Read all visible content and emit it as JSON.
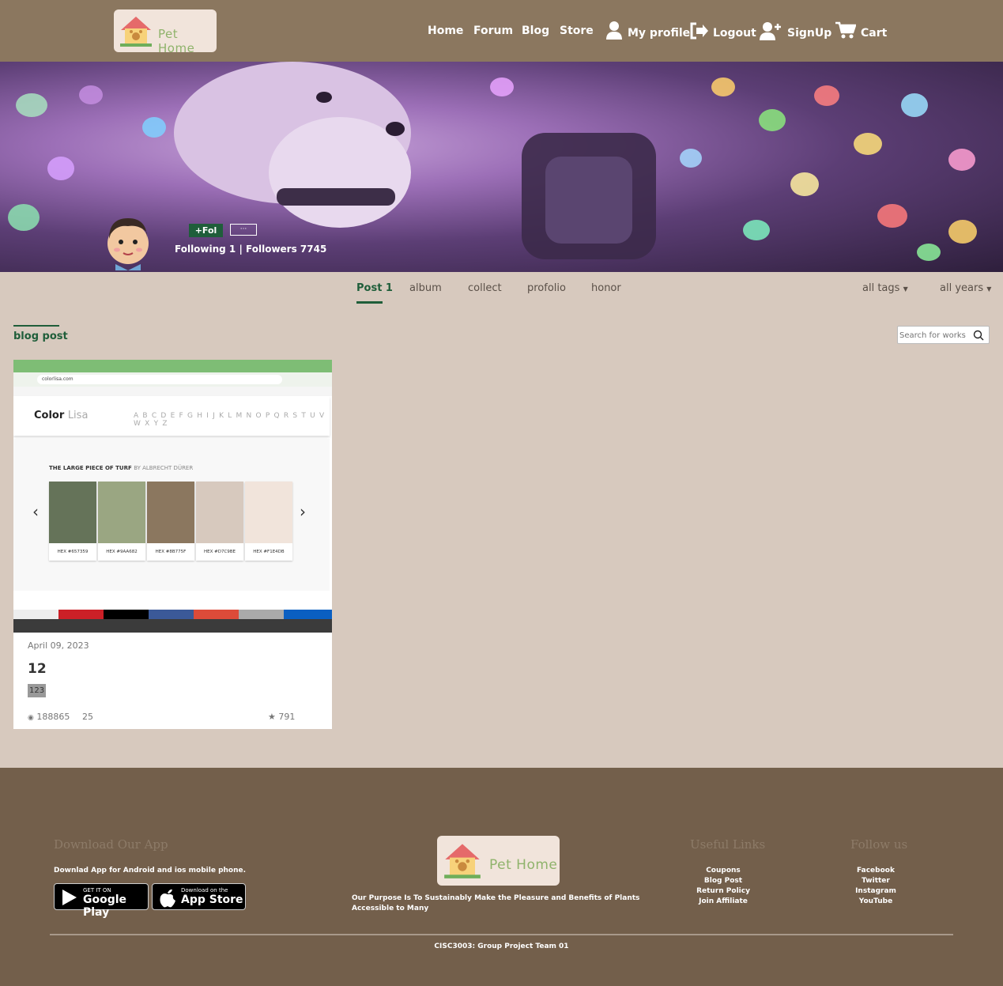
{
  "header": {
    "logo_text": "Pet Home",
    "nav": {
      "home": "Home",
      "forum": "Forum",
      "blog": "Blog",
      "store": "Store",
      "profile": "My profile",
      "logout": "Logout",
      "signup": "SignUp",
      "cart": "Cart"
    }
  },
  "profile": {
    "follow_button": "+Fol",
    "more_button": "···",
    "stats": "Following 1  |  Followers 7745"
  },
  "tabs": {
    "post": "Post 1",
    "album": "album",
    "collect": "collect",
    "profolio": "profolio",
    "honor": "honor"
  },
  "filters": {
    "tags": "all tags",
    "years": "all years"
  },
  "section": {
    "title": "blog post",
    "search_placeholder": "Search for works"
  },
  "post": {
    "screenshot": {
      "url": "colorlisa.com",
      "brand_main": "Color",
      "brand_sub": "Lisa",
      "alphabet": "A B C D E F G H I J K L M N O P Q R S T U V W X Y Z",
      "artwork_title": "THE LARGE PIECE OF TURF",
      "artwork_by": "BY ALBRECHT DÜRER",
      "swatches": [
        {
          "hex_label": "HEX #657359",
          "color": "#657359"
        },
        {
          "hex_label": "HEX #9AA682",
          "color": "#9AA682"
        },
        {
          "hex_label": "HEX #8B775F",
          "color": "#8B775F"
        },
        {
          "hex_label": "HEX #D7C9BE",
          "color": "#D7C9BE"
        },
        {
          "hex_label": "HEX #F1E4DB",
          "color": "#F1E4DB"
        }
      ]
    },
    "date": "April 09, 2023",
    "title": "12",
    "tag": "123",
    "views": "188865",
    "comments": "25",
    "stars": "791"
  },
  "footer": {
    "download_heading": "Download Our App",
    "download_text": "Downlad App for Android and ios mobile phone.",
    "google_small": "GET IT ON",
    "google_big": "Google Play",
    "apple_small": "Download on the",
    "apple_big": "App Store",
    "logo_text": "Pet Home",
    "purpose": "Our Purpose Is To Sustainably Make the Pleasure and Benefits of Plants Accessible to Many",
    "useful_heading": "Useful Links",
    "useful_links": [
      "Coupons",
      "Blog Post",
      "Return Policy",
      "Join Affiliate"
    ],
    "follow_heading": "Follow us",
    "follow_links": [
      "Facebook",
      "Twitter",
      "Instagram",
      "YouTube"
    ],
    "copyright": "CISC3003: Group Project Team 01"
  },
  "colors": {
    "header_bg": "#8b775f",
    "page_bg": "#d7c9be",
    "footer_bg": "#735f4b",
    "accent": "#1f5e3a",
    "logo_bg": "#f1e4db"
  }
}
